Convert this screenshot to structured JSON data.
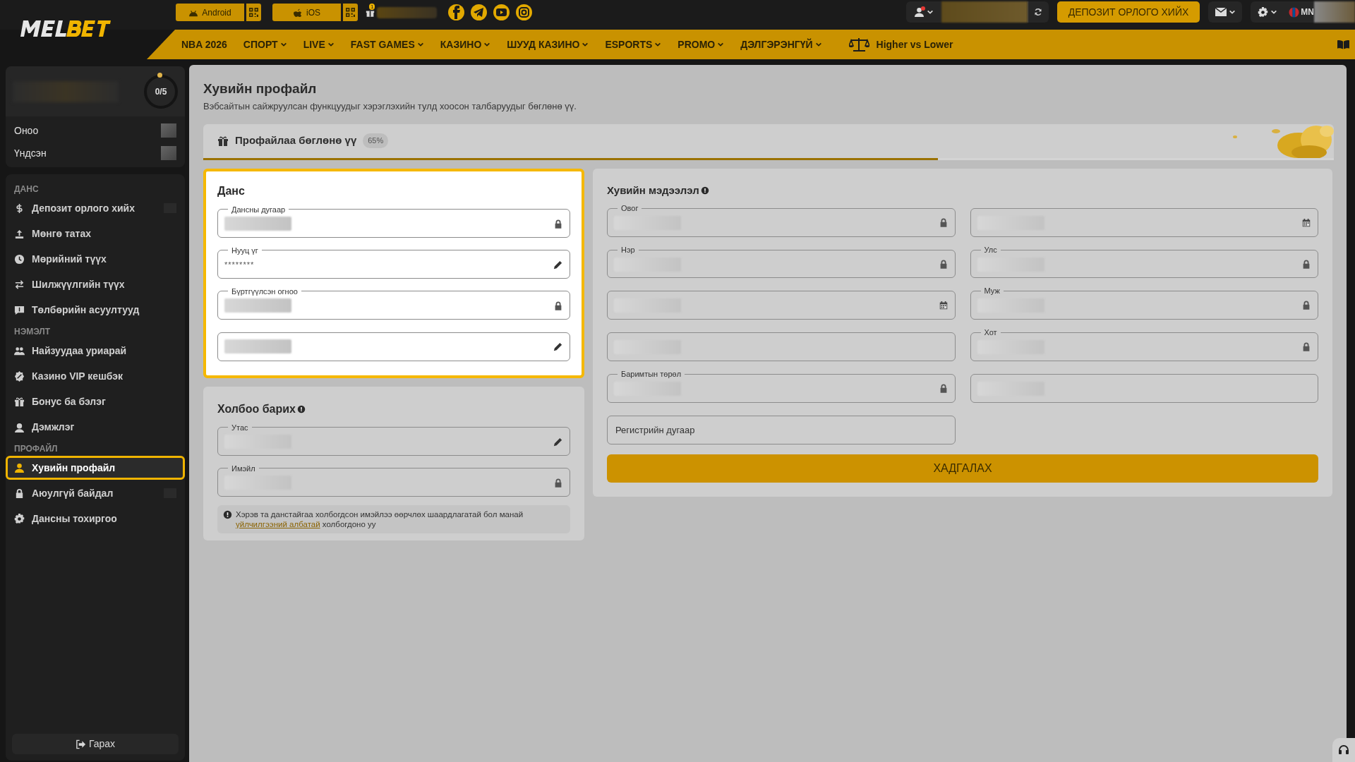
{
  "top_bar": {
    "app_buttons": [
      {
        "label": "Android"
      },
      {
        "label": "iOS"
      }
    ],
    "gift_badge": "1",
    "deposit_button": "ДЕПОЗИТ ОРЛОГО ХИЙХ",
    "language": "MN",
    "notification": true
  },
  "nav": {
    "items": [
      {
        "label": "NBA 2026",
        "dropdown": false
      },
      {
        "label": "СПОРТ",
        "dropdown": true
      },
      {
        "label": "LIVE",
        "dropdown": true
      },
      {
        "label": "FAST GAMES",
        "dropdown": true
      },
      {
        "label": "КАЗИНО",
        "dropdown": true
      },
      {
        "label": "ШУУД КАЗИНО",
        "dropdown": true
      },
      {
        "label": "ESPORTS",
        "dropdown": true
      },
      {
        "label": "PROMO",
        "dropdown": true
      },
      {
        "label": "ДЭЛГЭРЭНГҮЙ",
        "dropdown": true
      }
    ],
    "featured": "Higher vs Lower"
  },
  "sidebar": {
    "progress": "0/5",
    "balances": [
      {
        "label": "Оноо",
        "redacted": true
      },
      {
        "label": "Үндсэн",
        "redacted": true
      }
    ],
    "sections": [
      {
        "heading": "ДАНС",
        "items": [
          {
            "label": "Депозит орлого хийх",
            "selected": false,
            "redacted": true
          },
          {
            "label": "Мөнгө татах",
            "selected": false,
            "redacted": false
          },
          {
            "label": "Мөрийний түүх",
            "selected": false,
            "redacted": false
          },
          {
            "label": "Шилжүүлгийн түүх",
            "selected": false,
            "redacted": false
          },
          {
            "label": "Төлбөрийн асуултууд",
            "selected": false,
            "redacted": false
          }
        ]
      },
      {
        "heading": "НЭМЭЛТ",
        "items": [
          {
            "label": "Найзуудаа уриарай",
            "selected": false,
            "redacted": false
          },
          {
            "label": "Казино VIP кешбэк",
            "selected": false,
            "redacted": false
          },
          {
            "label": "Бонус ба бэлэг",
            "selected": false,
            "redacted": false
          },
          {
            "label": "Дэмжлэг",
            "selected": false,
            "redacted": false
          }
        ]
      },
      {
        "heading": "ПРОФАЙЛ",
        "items": [
          {
            "label": "Хувийн профайл",
            "selected": true,
            "redacted": false
          },
          {
            "label": "Аюулгүй байдал",
            "selected": false,
            "redacted": true
          },
          {
            "label": "Дансны тохиргоо",
            "selected": false,
            "redacted": false
          }
        ]
      }
    ],
    "logout": "Гарах"
  },
  "page": {
    "title": "Хувийн профайл",
    "subtitle": "Вэбсайтын сайжруулсан функцуудыг хэрэглэхийн тулд хоосон талбаруудыг бөглөнө үү.",
    "completion": {
      "label": "Профайлаа бөглөнө үү",
      "percent": "65%",
      "level": 0.65
    },
    "account": {
      "title": "Данс",
      "highlighted": true,
      "fields": [
        {
          "label": "Дансны дугаар",
          "redacted": true,
          "kind": "locked"
        },
        {
          "label": "Нууц үг",
          "value": "********",
          "redacted": false,
          "kind": "editable"
        },
        {
          "label": "Бүртгүүлсэн огноо",
          "redacted": true,
          "kind": "locked"
        },
        {
          "redacted": true,
          "kind": "editable"
        }
      ]
    },
    "contact": {
      "title": "Холбоо барих",
      "highlighted": false,
      "fields": [
        {
          "label": "Утас",
          "redacted": true,
          "kind": "editable"
        },
        {
          "label": "Имэйл",
          "redacted": true,
          "kind": "locked"
        }
      ],
      "note": "Хэрэв та данстайгаа холбогдсон имэйлээ өөрчлөх шаардлагатай бол манай",
      "note_link": "үйлчилгээний албатай",
      "note_end": "холбогдоно уу"
    },
    "personal": {
      "title": "Хувийн мэдээлэл",
      "fields": [
        {
          "label": "Овог",
          "redacted": true,
          "kind": "locked"
        },
        {
          "redacted": true,
          "kind": "date"
        },
        {
          "label": "Нэр",
          "redacted": true,
          "kind": "locked"
        },
        {
          "label": "Улс",
          "redacted": true,
          "kind": "locked"
        },
        {
          "redacted": true,
          "kind": "date"
        },
        {
          "label": "Муж",
          "redacted": true,
          "kind": "locked"
        },
        {
          "redacted": true,
          "kind": "plain"
        },
        {
          "label": "Хот",
          "redacted": true,
          "kind": "locked"
        },
        {
          "label": "Баримтын төрөл",
          "redacted": true,
          "kind": "locked"
        },
        {
          "redacted": true,
          "kind": "plain"
        },
        {
          "placeholder": "Регистрийн дугаар"
        }
      ],
      "save_button": "ХАДГАЛАХ"
    }
  }
}
